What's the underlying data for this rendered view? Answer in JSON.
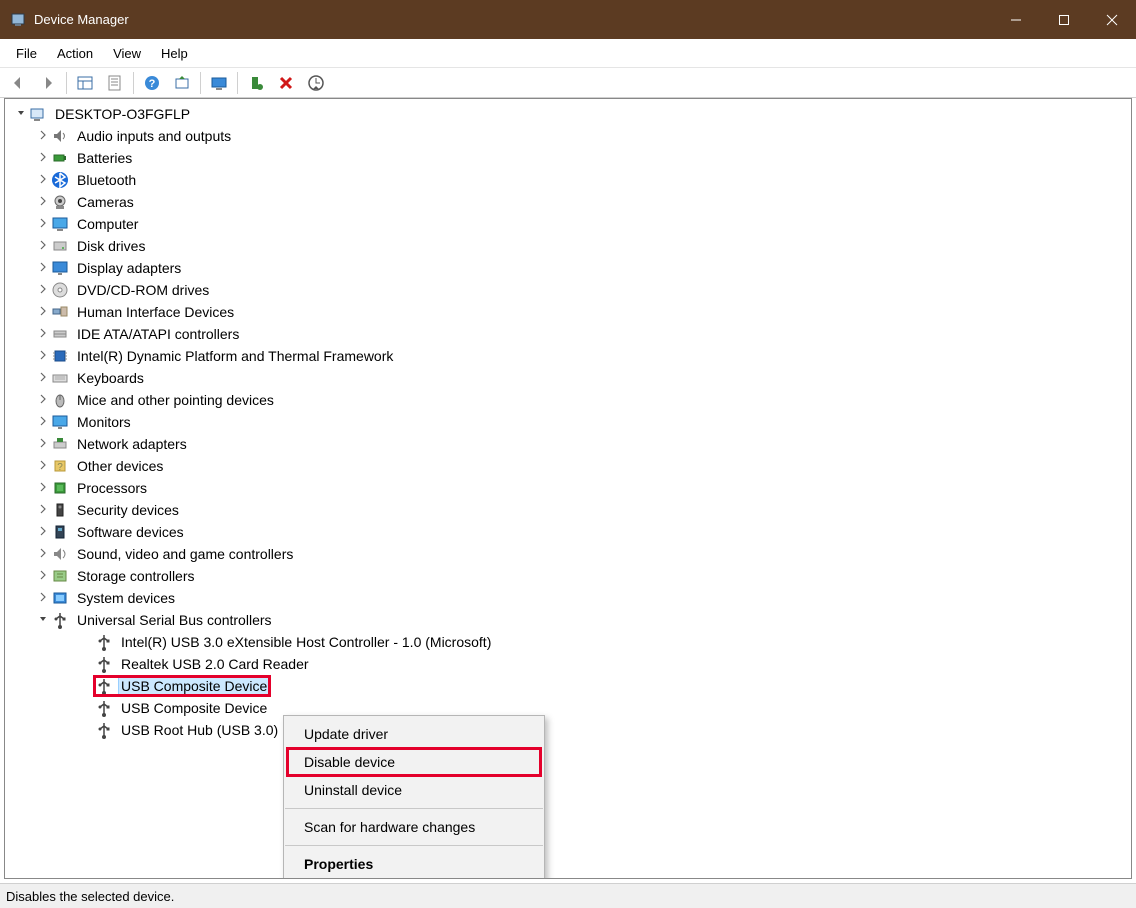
{
  "window": {
    "title": "Device Manager"
  },
  "menubar": {
    "items": [
      "File",
      "Action",
      "View",
      "Help"
    ]
  },
  "toolbar_icons": [
    "back",
    "forward",
    "sep",
    "show-hide",
    "properties",
    "sep",
    "help",
    "update",
    "sep",
    "remote",
    "sep",
    "enable",
    "disable",
    "scan"
  ],
  "root_node": "DESKTOP-O3FGFLP",
  "categories": [
    {
      "label": "Audio inputs and outputs",
      "icon": "speaker",
      "expanded": false
    },
    {
      "label": "Batteries",
      "icon": "battery",
      "expanded": false
    },
    {
      "label": "Bluetooth",
      "icon": "bluetooth",
      "expanded": false
    },
    {
      "label": "Cameras",
      "icon": "camera",
      "expanded": false
    },
    {
      "label": "Computer",
      "icon": "computer",
      "expanded": false
    },
    {
      "label": "Disk drives",
      "icon": "disk",
      "expanded": false
    },
    {
      "label": "Display adapters",
      "icon": "display",
      "expanded": false
    },
    {
      "label": "DVD/CD-ROM drives",
      "icon": "dvd",
      "expanded": false
    },
    {
      "label": "Human Interface Devices",
      "icon": "hid",
      "expanded": false
    },
    {
      "label": "IDE ATA/ATAPI controllers",
      "icon": "ide",
      "expanded": false
    },
    {
      "label": "Intel(R) Dynamic Platform and Thermal Framework",
      "icon": "chip",
      "expanded": false
    },
    {
      "label": "Keyboards",
      "icon": "keyboard",
      "expanded": false
    },
    {
      "label": "Mice and other pointing devices",
      "icon": "mouse",
      "expanded": false
    },
    {
      "label": "Monitors",
      "icon": "monitor",
      "expanded": false
    },
    {
      "label": "Network adapters",
      "icon": "network",
      "expanded": false
    },
    {
      "label": "Other devices",
      "icon": "other",
      "expanded": false
    },
    {
      "label": "Processors",
      "icon": "cpu",
      "expanded": false
    },
    {
      "label": "Security devices",
      "icon": "security",
      "expanded": false
    },
    {
      "label": "Software devices",
      "icon": "software",
      "expanded": false
    },
    {
      "label": "Sound, video and game controllers",
      "icon": "sound",
      "expanded": false
    },
    {
      "label": "Storage controllers",
      "icon": "storage",
      "expanded": false
    },
    {
      "label": "System devices",
      "icon": "system",
      "expanded": false
    },
    {
      "label": "Universal Serial Bus controllers",
      "icon": "usb",
      "expanded": true,
      "children": [
        {
          "label": "Intel(R) USB 3.0 eXtensible Host Controller - 1.0 (Microsoft)",
          "icon": "usb-dev",
          "selected": false,
          "highlighted": false
        },
        {
          "label": "Realtek USB 2.0 Card Reader",
          "icon": "usb-dev",
          "selected": false,
          "highlighted": false
        },
        {
          "label": "USB Composite Device",
          "icon": "usb-dev",
          "selected": true,
          "highlighted": true
        },
        {
          "label": "USB Composite Device",
          "icon": "usb-dev",
          "selected": false,
          "highlighted": false
        },
        {
          "label": "USB Root Hub (USB 3.0)",
          "icon": "usb-dev",
          "selected": false,
          "highlighted": false
        }
      ]
    }
  ],
  "context_menu": {
    "items": [
      {
        "label": "Update driver",
        "highlighted": false
      },
      {
        "label": "Disable device",
        "highlighted": true
      },
      {
        "label": "Uninstall device",
        "highlighted": false
      },
      {
        "sep": true
      },
      {
        "label": "Scan for hardware changes",
        "highlighted": false
      },
      {
        "sep": true
      },
      {
        "label": "Properties",
        "bold": true,
        "highlighted": false
      }
    ]
  },
  "statusbar": {
    "text": "Disables the selected device."
  }
}
